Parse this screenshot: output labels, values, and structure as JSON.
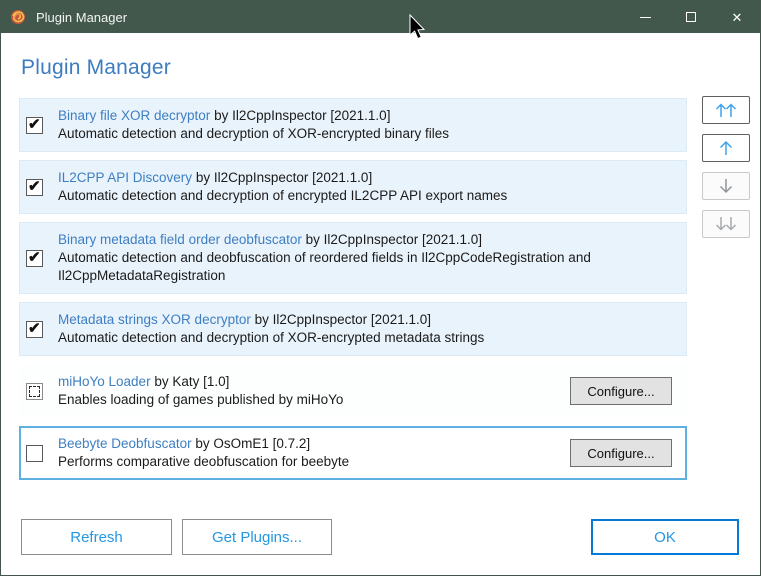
{
  "window": {
    "title": "Plugin Manager"
  },
  "header": {
    "title": "Plugin Manager"
  },
  "plugins": [
    {
      "name": "Binary file XOR decryptor",
      "byline": "by Il2CppInspector [2021.1.0]",
      "description": "Automatic detection and decryption of XOR-encrypted binary files",
      "state": "checked"
    },
    {
      "name": "IL2CPP API Discovery",
      "byline": "by Il2CppInspector [2021.1.0]",
      "description": "Automatic detection and decryption of encrypted IL2CPP API export names",
      "state": "checked"
    },
    {
      "name": "Binary metadata field order deobfuscator",
      "byline": "by Il2CppInspector [2021.1.0]",
      "description": "Automatic detection and deobfuscation of reordered fields in Il2CppCodeRegistration and Il2CppMetadataRegistration",
      "state": "checked"
    },
    {
      "name": "Metadata strings XOR decryptor",
      "byline": "by Il2CppInspector [2021.1.0]",
      "description": "Automatic detection and decryption of XOR-encrypted metadata strings",
      "state": "checked"
    },
    {
      "name": "miHoYo Loader",
      "byline": "by Katy [1.0]",
      "description": "Enables loading of games published by miHoYo",
      "state": "indeterminate",
      "configure_label": "Configure..."
    },
    {
      "name": "Beebyte Deobfuscator",
      "byline": "by OsOmE1 [0.7.2]",
      "description": "Performs comparative deobfuscation for beebyte",
      "state": "unchecked",
      "selected": true,
      "configure_label": "Configure..."
    }
  ],
  "footer": {
    "refresh_label": "Refresh",
    "get_plugins_label": "Get Plugins...",
    "ok_label": "OK"
  },
  "colors": {
    "titlebar": "#42584D",
    "heading_blue": "#3C7CC0",
    "link_blue": "#3E7EC2",
    "row_background": "#E9F3FB",
    "selected_border": "#5EB0E0",
    "accent_blue": "#0579D7",
    "button_text_blue": "#2497E3"
  }
}
